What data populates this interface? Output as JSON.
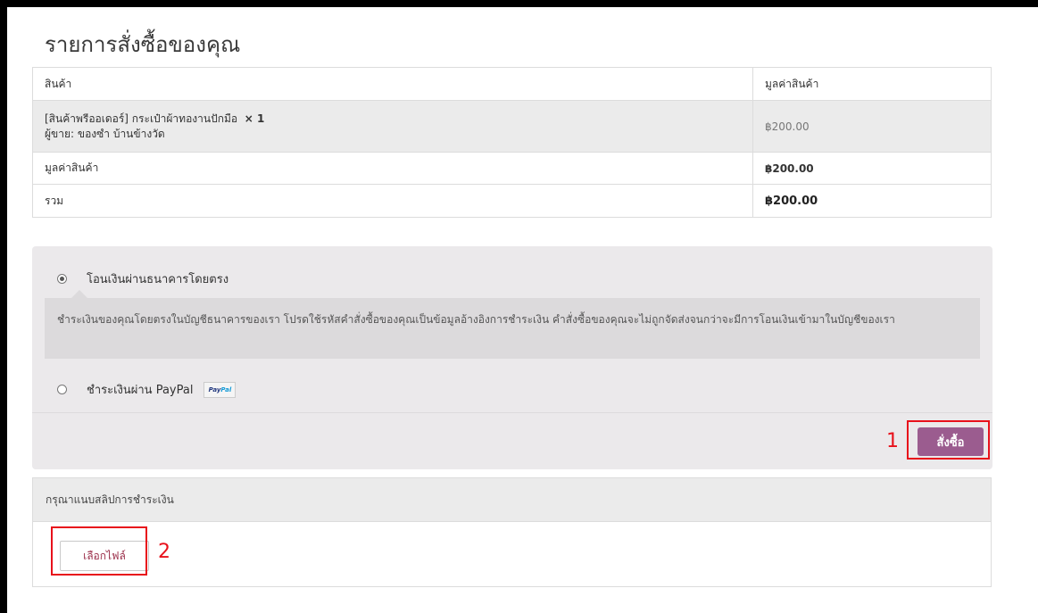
{
  "page": {
    "title": "รายการสั่งซื้อของคุณ"
  },
  "order_table": {
    "headers": {
      "product": "สินค้า",
      "price": "มูลค่าสินค้า"
    },
    "item": {
      "name": "[สินค้าพรีออเดอร์] กระเป๋าผ้าทองานปักมือ",
      "qty": "× 1",
      "vendor": "ผู้ขาย: ของซำ บ้านข้างวัด",
      "price": "฿200.00"
    },
    "subtotal": {
      "label": "มูลค่าสินค้า",
      "value": "฿200.00"
    },
    "total": {
      "label": "รวม",
      "value": "฿200.00"
    }
  },
  "payment": {
    "methods": [
      {
        "label": "โอนเงินผ่านธนาคารโดยตรง",
        "selected": true
      },
      {
        "label": "ชำระเงินผ่าน PayPal",
        "selected": false,
        "logo": "PayPal"
      }
    ],
    "description": "ชำระเงินของคุณโดยตรงในบัญชีธนาคารของเรา โปรดใช้รหัสคำสั่งซื้อของคุณเป็นข้อมูลอ้างอิงการชำระเงิน คำสั่งซื้อของคุณจะไม่ถูกจัดส่งจนกว่าจะมีการโอนเงินเข้ามาในบัญชีของเรา",
    "order_button": "สั่งซื้อ"
  },
  "upload": {
    "header": "กรุณาแนบสลิปการชำระเงิน",
    "file_button": "เลือกไฟล์"
  },
  "annotations": {
    "first": "1",
    "second": "2"
  },
  "colors": {
    "accent": "#9b5c8f",
    "highlight": "#e8111b"
  }
}
